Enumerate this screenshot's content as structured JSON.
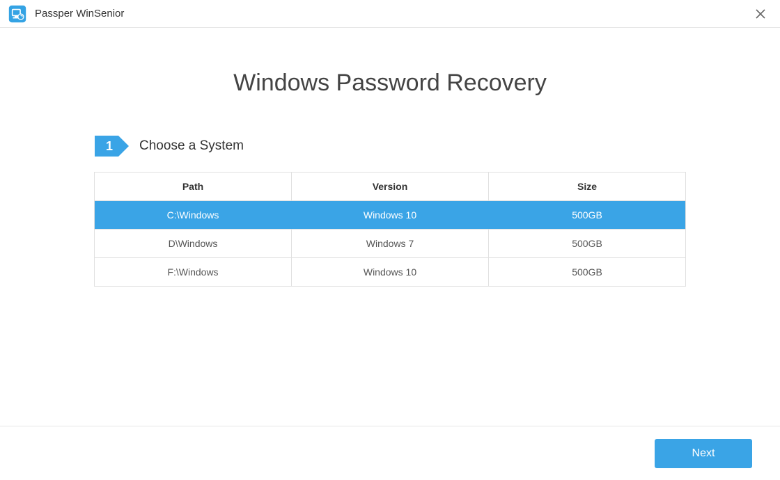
{
  "app": {
    "title": "Passper WinSenior"
  },
  "page": {
    "heading": "Windows Password Recovery"
  },
  "step": {
    "number": "1",
    "label": "Choose a System"
  },
  "table": {
    "headers": {
      "path": "Path",
      "version": "Version",
      "size": "Size"
    },
    "rows": [
      {
        "path": "C:\\Windows",
        "version": "Windows 10",
        "size": "500GB",
        "selected": true
      },
      {
        "path": "D\\Windows",
        "version": "Windows 7",
        "size": "500GB",
        "selected": false
      },
      {
        "path": "F:\\Windows",
        "version": "Windows 10",
        "size": "500GB",
        "selected": false
      }
    ]
  },
  "footer": {
    "next_label": "Next"
  },
  "colors": {
    "accent": "#3aa4e6"
  }
}
